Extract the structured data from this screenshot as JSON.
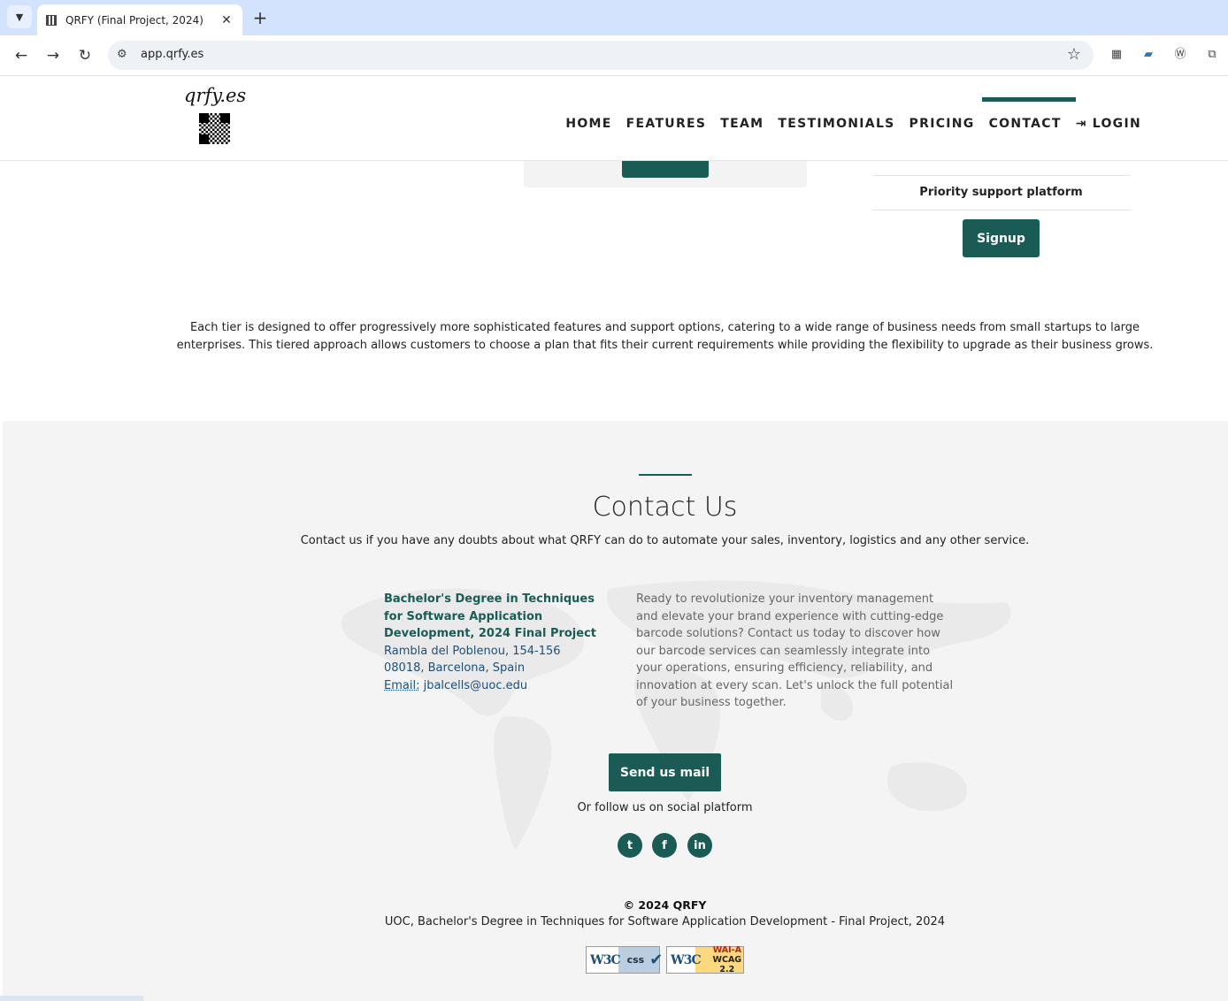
{
  "browser": {
    "tab_title": "QRFY (Final Project, 2024)",
    "url": "app.qrfy.es",
    "tab_menu_icon": "chevron-down-icon",
    "close_glyph": "✕",
    "new_tab_glyph": "+"
  },
  "header": {
    "logo_text": "qrfy.es",
    "nav": [
      {
        "label": "HOME"
      },
      {
        "label": "FEATURES"
      },
      {
        "label": "TEAM"
      },
      {
        "label": "TESTIMONIALS"
      },
      {
        "label": "PRICING"
      },
      {
        "label": "CONTACT",
        "active": true
      },
      {
        "label": "LOGIN",
        "icon": "sign-in-icon"
      }
    ]
  },
  "pricing": {
    "feature_priority": "Priority support platform",
    "signup_label": "Signup",
    "tier_description": "Each tier is designed to offer progressively more sophisticated features and support options, catering to a wide range of business needs from small startups to large enterprises. This tiered approach allows customers to choose a plan that fits their current requirements while providing the flexibility to upgrade as their business grows."
  },
  "contact": {
    "title": "Contact Us",
    "subtitle": "Contact us if you have any doubts about what QRFY can do to automate your sales, inventory, logistics and any other service.",
    "address_title": "Bachelor's Degree in Techniques for Software Application Development, 2024 Final Project",
    "address_line1": "Rambla del Poblenou, 154-156",
    "address_line2": "08018, Barcelona, Spain",
    "email_label": "Email:",
    "email": "jbalcells@uoc.edu",
    "pitch": "Ready to revolutionize your inventory management and elevate your brand experience with cutting-edge barcode solutions? Contact us today to discover how our barcode services can seamlessly integrate into your operations, ensuring efficiency, reliability, and innovation at every scan. Let's unlock the full potential of your business together.",
    "mail_button": "Send us mail",
    "follow_text": "Or follow us on social platform",
    "social": [
      "twitter-icon",
      "facebook-icon",
      "linkedin-icon"
    ]
  },
  "footer": {
    "copyright": "© 2024 QRFY",
    "line": "UOC, Bachelor's Degree in Techniques for Software Application Development - Final Project, 2024",
    "badge_css_w3c": "W3C",
    "badge_css": "css",
    "badge_wcag_w3c": "W3C",
    "badge_wcag_1": "WAI-A",
    "badge_wcag_2": "WCAG 2.2"
  },
  "colors": {
    "accent": "#1a5c55",
    "tabbar": "#d3e3fd",
    "section_bg": "#f4f4f4"
  }
}
